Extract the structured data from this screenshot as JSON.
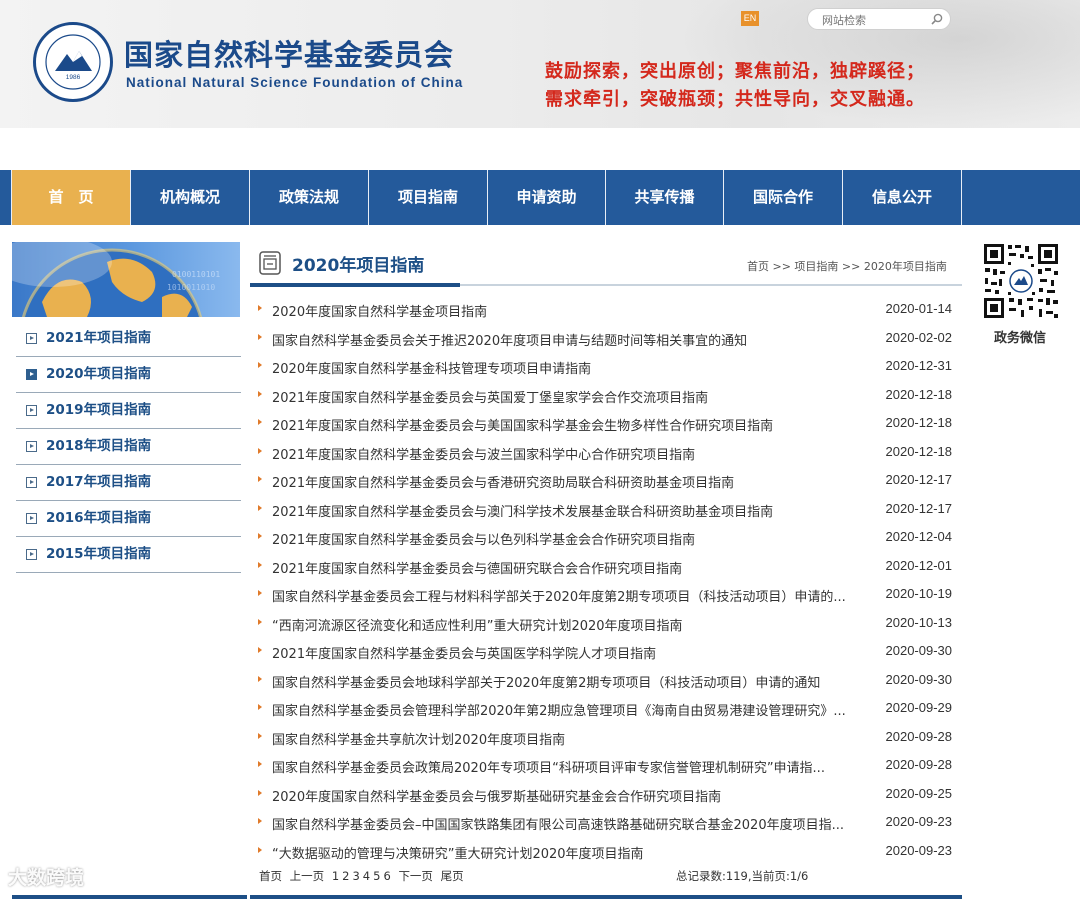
{
  "header": {
    "title_cn": "国家自然科学基金委员会",
    "title_en": "National Natural Science Foundation of China",
    "logo_year": "1986",
    "logo_ring_text": "国家自然科学基金委员会 NATIONAL NATURAL SCIENCE FOUNDATION OF CHINA",
    "lang_button": "EN",
    "search_placeholder": "网站检索",
    "slogan_line1": "鼓励探索，突出原创；聚焦前沿，独辟蹊径；",
    "slogan_line2": "需求牵引，突破瓶颈；共性导向，交叉融通。",
    "brand_color": "#1b4a8a",
    "slogan_color": "#d4281c"
  },
  "nav": {
    "items": [
      "首　页",
      "机构概况",
      "政策法规",
      "项目指南",
      "申请资助",
      "共享传播",
      "国际合作",
      "信息公开"
    ],
    "active_index": 0,
    "bar_color": "#245a9b",
    "active_color": "#e9b14f"
  },
  "sidebar": {
    "items": [
      "2021年项目指南",
      "2020年项目指南",
      "2019年项目指南",
      "2018年项目指南",
      "2017年项目指南",
      "2016年项目指南",
      "2015年项目指南"
    ],
    "active_index": 1
  },
  "main": {
    "title": "2020年项目指南",
    "breadcrumb": "首页 >> 项目指南 >> 2020年项目指南",
    "list": [
      {
        "title": "2020年度国家自然科学基金项目指南",
        "date": "2020-01-14"
      },
      {
        "title": "国家自然科学基金委员会关于推迟2020年度项目申请与结题时间等相关事宜的通知",
        "date": "2020-02-02"
      },
      {
        "title": "2020年度国家自然科学基金科技管理专项项目申请指南",
        "date": "2020-12-31"
      },
      {
        "title": "2021年度国家自然科学基金委员会与英国爱丁堡皇家学会合作交流项目指南",
        "date": "2020-12-18"
      },
      {
        "title": "2021年度国家自然科学基金委员会与美国国家科学基金会生物多样性合作研究项目指南",
        "date": "2020-12-18"
      },
      {
        "title": "2021年度国家自然科学基金委员会与波兰国家科学中心合作研究项目指南",
        "date": "2020-12-18"
      },
      {
        "title": "2021年度国家自然科学基金委员会与香港研究资助局联合科研资助基金项目指南",
        "date": "2020-12-17"
      },
      {
        "title": "2021年度国家自然科学基金委员会与澳门科学技术发展基金联合科研资助基金项目指南",
        "date": "2020-12-17"
      },
      {
        "title": "2021年度国家自然科学基金委员会与以色列科学基金会合作研究项目指南",
        "date": "2020-12-04"
      },
      {
        "title": "2021年度国家自然科学基金委员会与德国研究联合会合作研究项目指南",
        "date": "2020-12-01"
      },
      {
        "title": "国家自然科学基金委员会工程与材料科学部关于2020年度第2期专项项目（科技活动项目）申请的...",
        "date": "2020-10-19"
      },
      {
        "title": "“西南河流源区径流变化和适应性利用”重大研究计划2020年度项目指南",
        "date": "2020-10-13"
      },
      {
        "title": "2021年度国家自然科学基金委员会与英国医学科学院人才项目指南",
        "date": "2020-09-30"
      },
      {
        "title": "国家自然科学基金委员会地球科学部关于2020年度第2期专项项目（科技活动项目）申请的通知",
        "date": "2020-09-30"
      },
      {
        "title": "国家自然科学基金委员会管理科学部2020年第2期应急管理项目《海南自由贸易港建设管理研究》...",
        "date": "2020-09-29"
      },
      {
        "title": "国家自然科学基金共享航次计划2020年度项目指南",
        "date": "2020-09-28"
      },
      {
        "title": "国家自然科学基金委员会政策局2020年专项项目“科研项目评审专家信誉管理机制研究”申请指...",
        "date": "2020-09-28"
      },
      {
        "title": "2020年度国家自然科学基金委员会与俄罗斯基础研究基金会合作研究项目指南",
        "date": "2020-09-25"
      },
      {
        "title": "国家自然科学基金委员会–中国国家铁路集团有限公司高速铁路基础研究联合基金2020年度项目指...",
        "date": "2020-09-23"
      },
      {
        "title": "“大数据驱动的管理与决策研究”重大研究计划2020年度项目指南",
        "date": "2020-09-23"
      }
    ]
  },
  "pager": {
    "first": "首页",
    "prev": "上一页",
    "pages": [
      "1",
      "2",
      "3",
      "4",
      "5",
      "6"
    ],
    "next": "下一页",
    "last": "尾页",
    "records": "总记录数:119,当前页:1/6"
  },
  "right": {
    "qr_label": "政务微信"
  },
  "watermark": "大数跨境"
}
